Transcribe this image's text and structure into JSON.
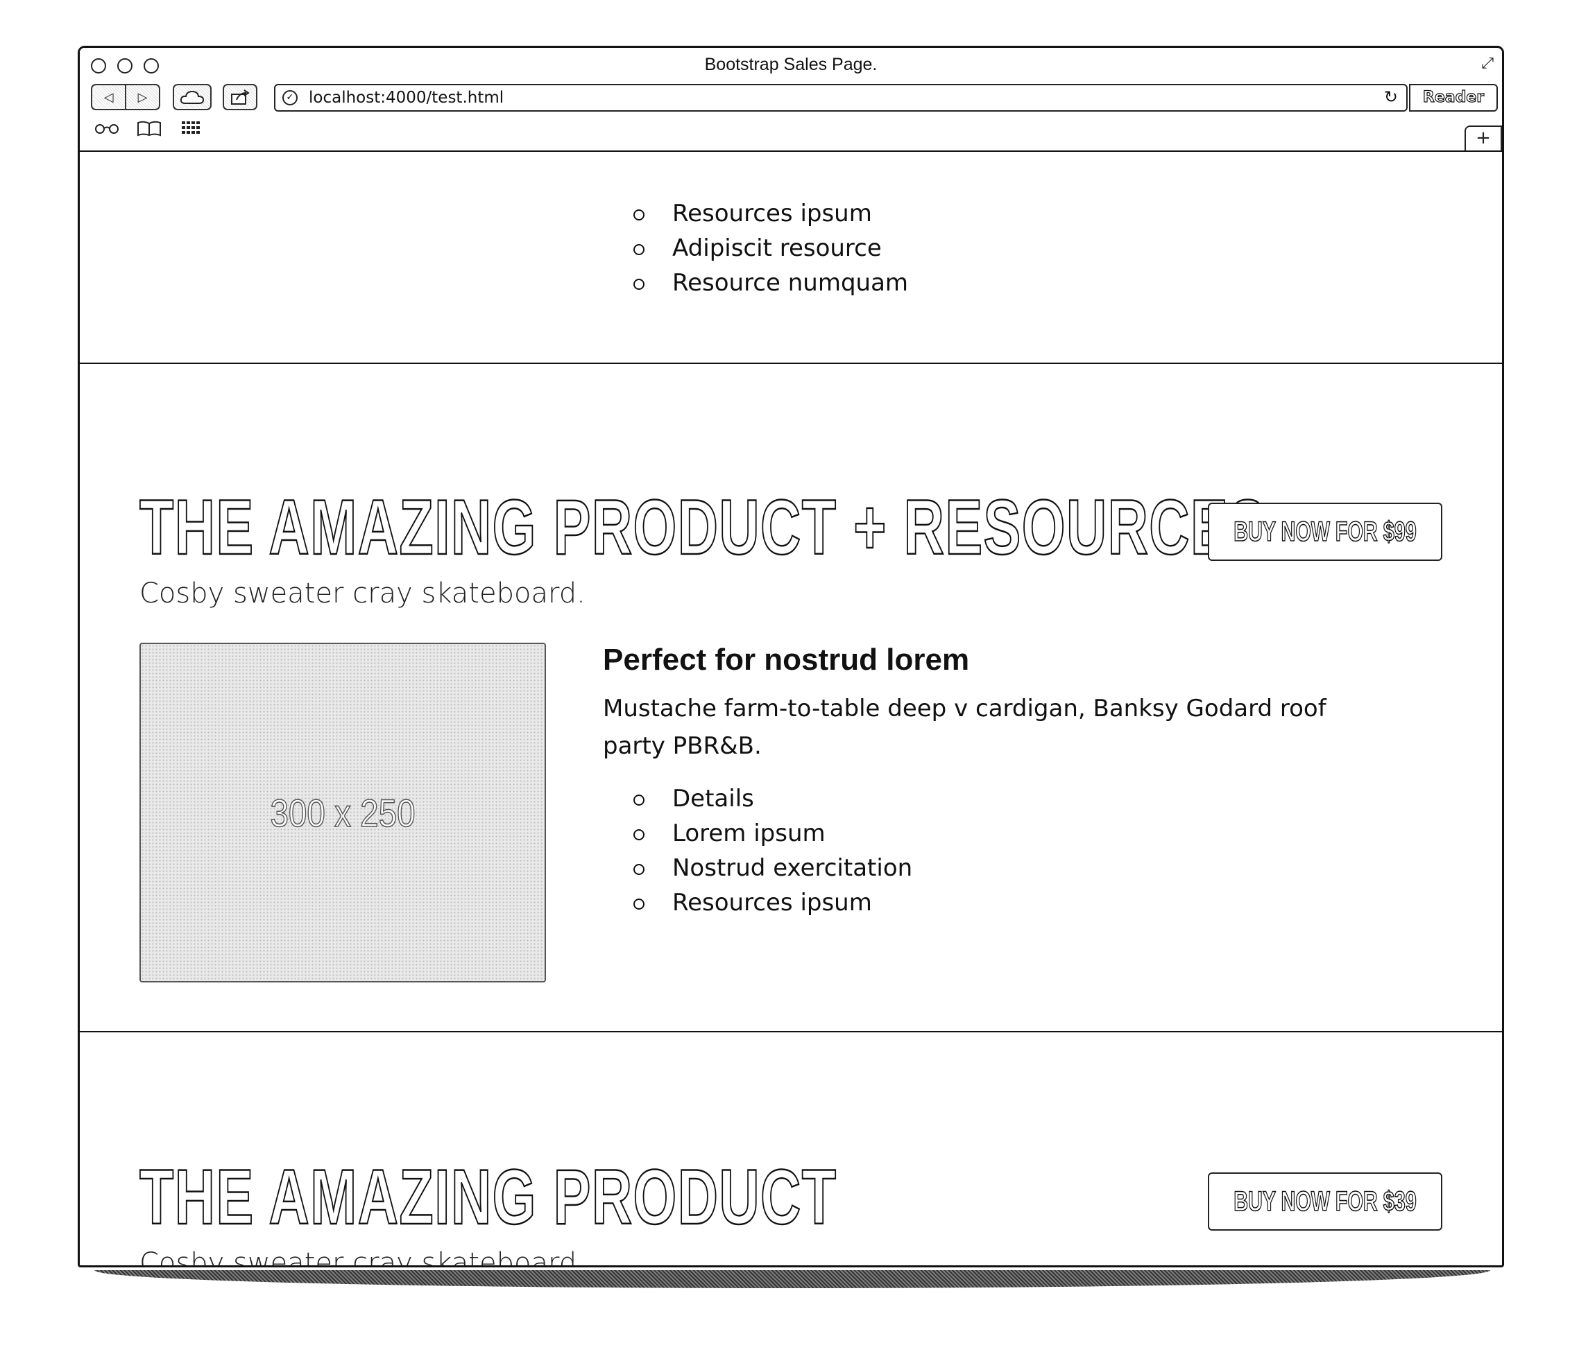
{
  "window": {
    "title": "Bootstrap Sales Page.",
    "url": "localhost:4000/test.html",
    "reader_label": "Reader",
    "new_tab_label": "+"
  },
  "top_list": {
    "items": [
      "Resources ipsum",
      "Adipiscit resource",
      "Resource numquam"
    ]
  },
  "section_resources": {
    "title": "THE AMAZING PRODUCT + RESOURCES",
    "subtitle": "Cosby sweater cray skateboard.",
    "buy_label": "BUY NOW FOR $99",
    "image_placeholder": "300 x 250",
    "feature_heading": "Perfect for nostrud lorem",
    "feature_text": "Mustache farm-to-table deep v cardigan, Banksy Godard roof party PBR&B.",
    "list": [
      "Details",
      "Lorem ipsum",
      "Nostrud exercitation",
      "Resources ipsum"
    ]
  },
  "section_product": {
    "title": "THE AMAZING PRODUCT",
    "subtitle": "Cosby sweater cray skateboard.",
    "buy_label": "BUY NOW FOR $39"
  }
}
